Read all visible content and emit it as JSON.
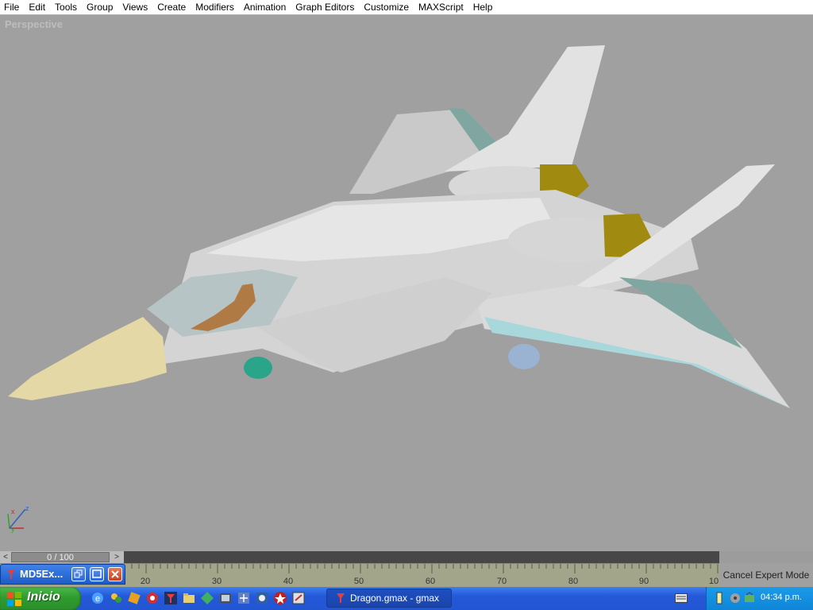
{
  "menu": [
    "File",
    "Edit",
    "Tools",
    "Group",
    "Views",
    "Create",
    "Modifiers",
    "Animation",
    "Graph Editors",
    "Customize",
    "MAXScript",
    "Help"
  ],
  "viewport": {
    "label": "Perspective"
  },
  "axis": {
    "x": "x",
    "y": "y",
    "z": "z"
  },
  "timeslider": {
    "frame": "0 / 100",
    "left_arrow": "<",
    "right_arrow": ">"
  },
  "trackbar": {
    "ticks": [
      "20",
      "30",
      "40",
      "50",
      "60",
      "70",
      "80",
      "90",
      "10"
    ]
  },
  "cancel_expert_label": "Cancel Expert Mode",
  "mini_window": {
    "title": "MD5Ex..."
  },
  "taskbar": {
    "start_label": "Inicio",
    "task_label": "Dragon.gmax - gmax",
    "clock": "04:34 p.m."
  },
  "colors": {
    "viewport_bg": "#a0a0a0",
    "taskbar": "#2458d8",
    "start": "#2e9a2e",
    "tray": "#1a9be8"
  }
}
